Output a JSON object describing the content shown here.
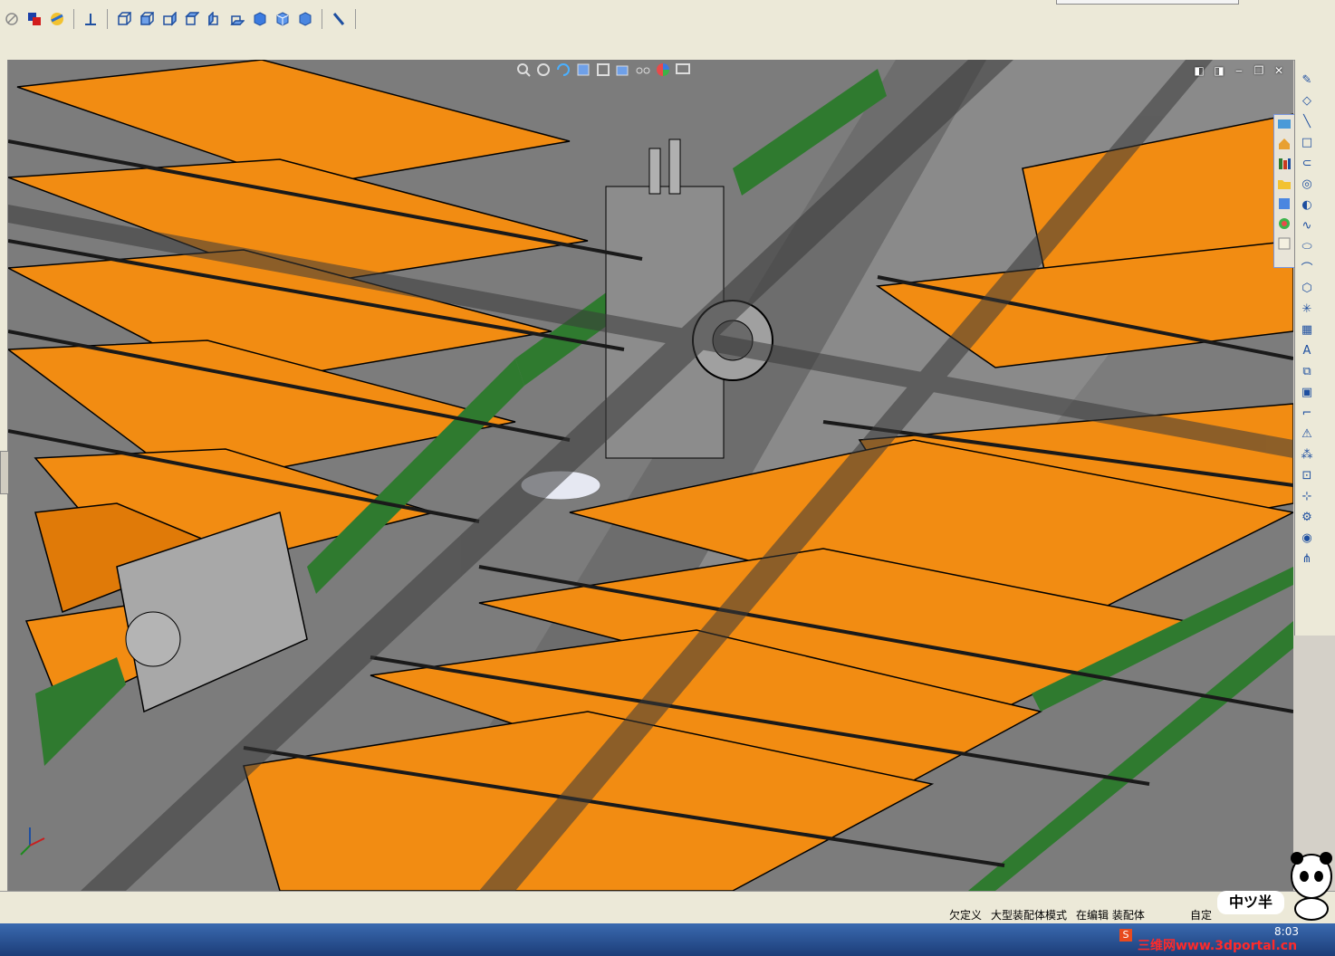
{
  "toolbar": {
    "icons": [
      "close-circle-icon",
      "color-squares-icon",
      "render-sphere-icon",
      "axis-icon",
      "view-iso-icon",
      "view-front-icon",
      "view-right-icon",
      "view-top-icon",
      "view-left-icon",
      "view-bottom-icon",
      "view-back-icon",
      "view-cube-icon",
      "measure-icon"
    ]
  },
  "viewport": {
    "bg_color": "#7c7c7c",
    "part_color": "#f28c12",
    "frame_color": "#2f7a2f",
    "view_icons": [
      "zoom-icon",
      "pan-icon",
      "rotate-icon",
      "section-icon",
      "display-icon",
      "hide-icon",
      "glasses-icon",
      "color-wheel-icon",
      "screen-icon"
    ]
  },
  "right_panel": {
    "items": [
      "sketch-icon",
      "edit-icon",
      "line-icon",
      "rectangle-icon",
      "slot-icon",
      "circle-icon",
      "arc-icon",
      "spline-icon",
      "ellipse-icon",
      "fillet-icon",
      "polygon-icon",
      "point-icon",
      "grid-icon",
      "text-icon",
      "mirror-icon",
      "offset-icon",
      "trim-icon",
      "warning-icon",
      "pattern-icon",
      "relation-icon",
      "dimension-icon",
      "repair-icon",
      "quick-snap-icon",
      "magnet-icon"
    ]
  },
  "status": {
    "under_defined": "欠定义",
    "mode": "大型装配体模式",
    "editing": "在编辑 装配体",
    "custom": "自定"
  },
  "taskbar": {
    "time": "8:03",
    "watermark": "三维网www.3dportal.cn"
  },
  "panda_label": "中ツ半"
}
